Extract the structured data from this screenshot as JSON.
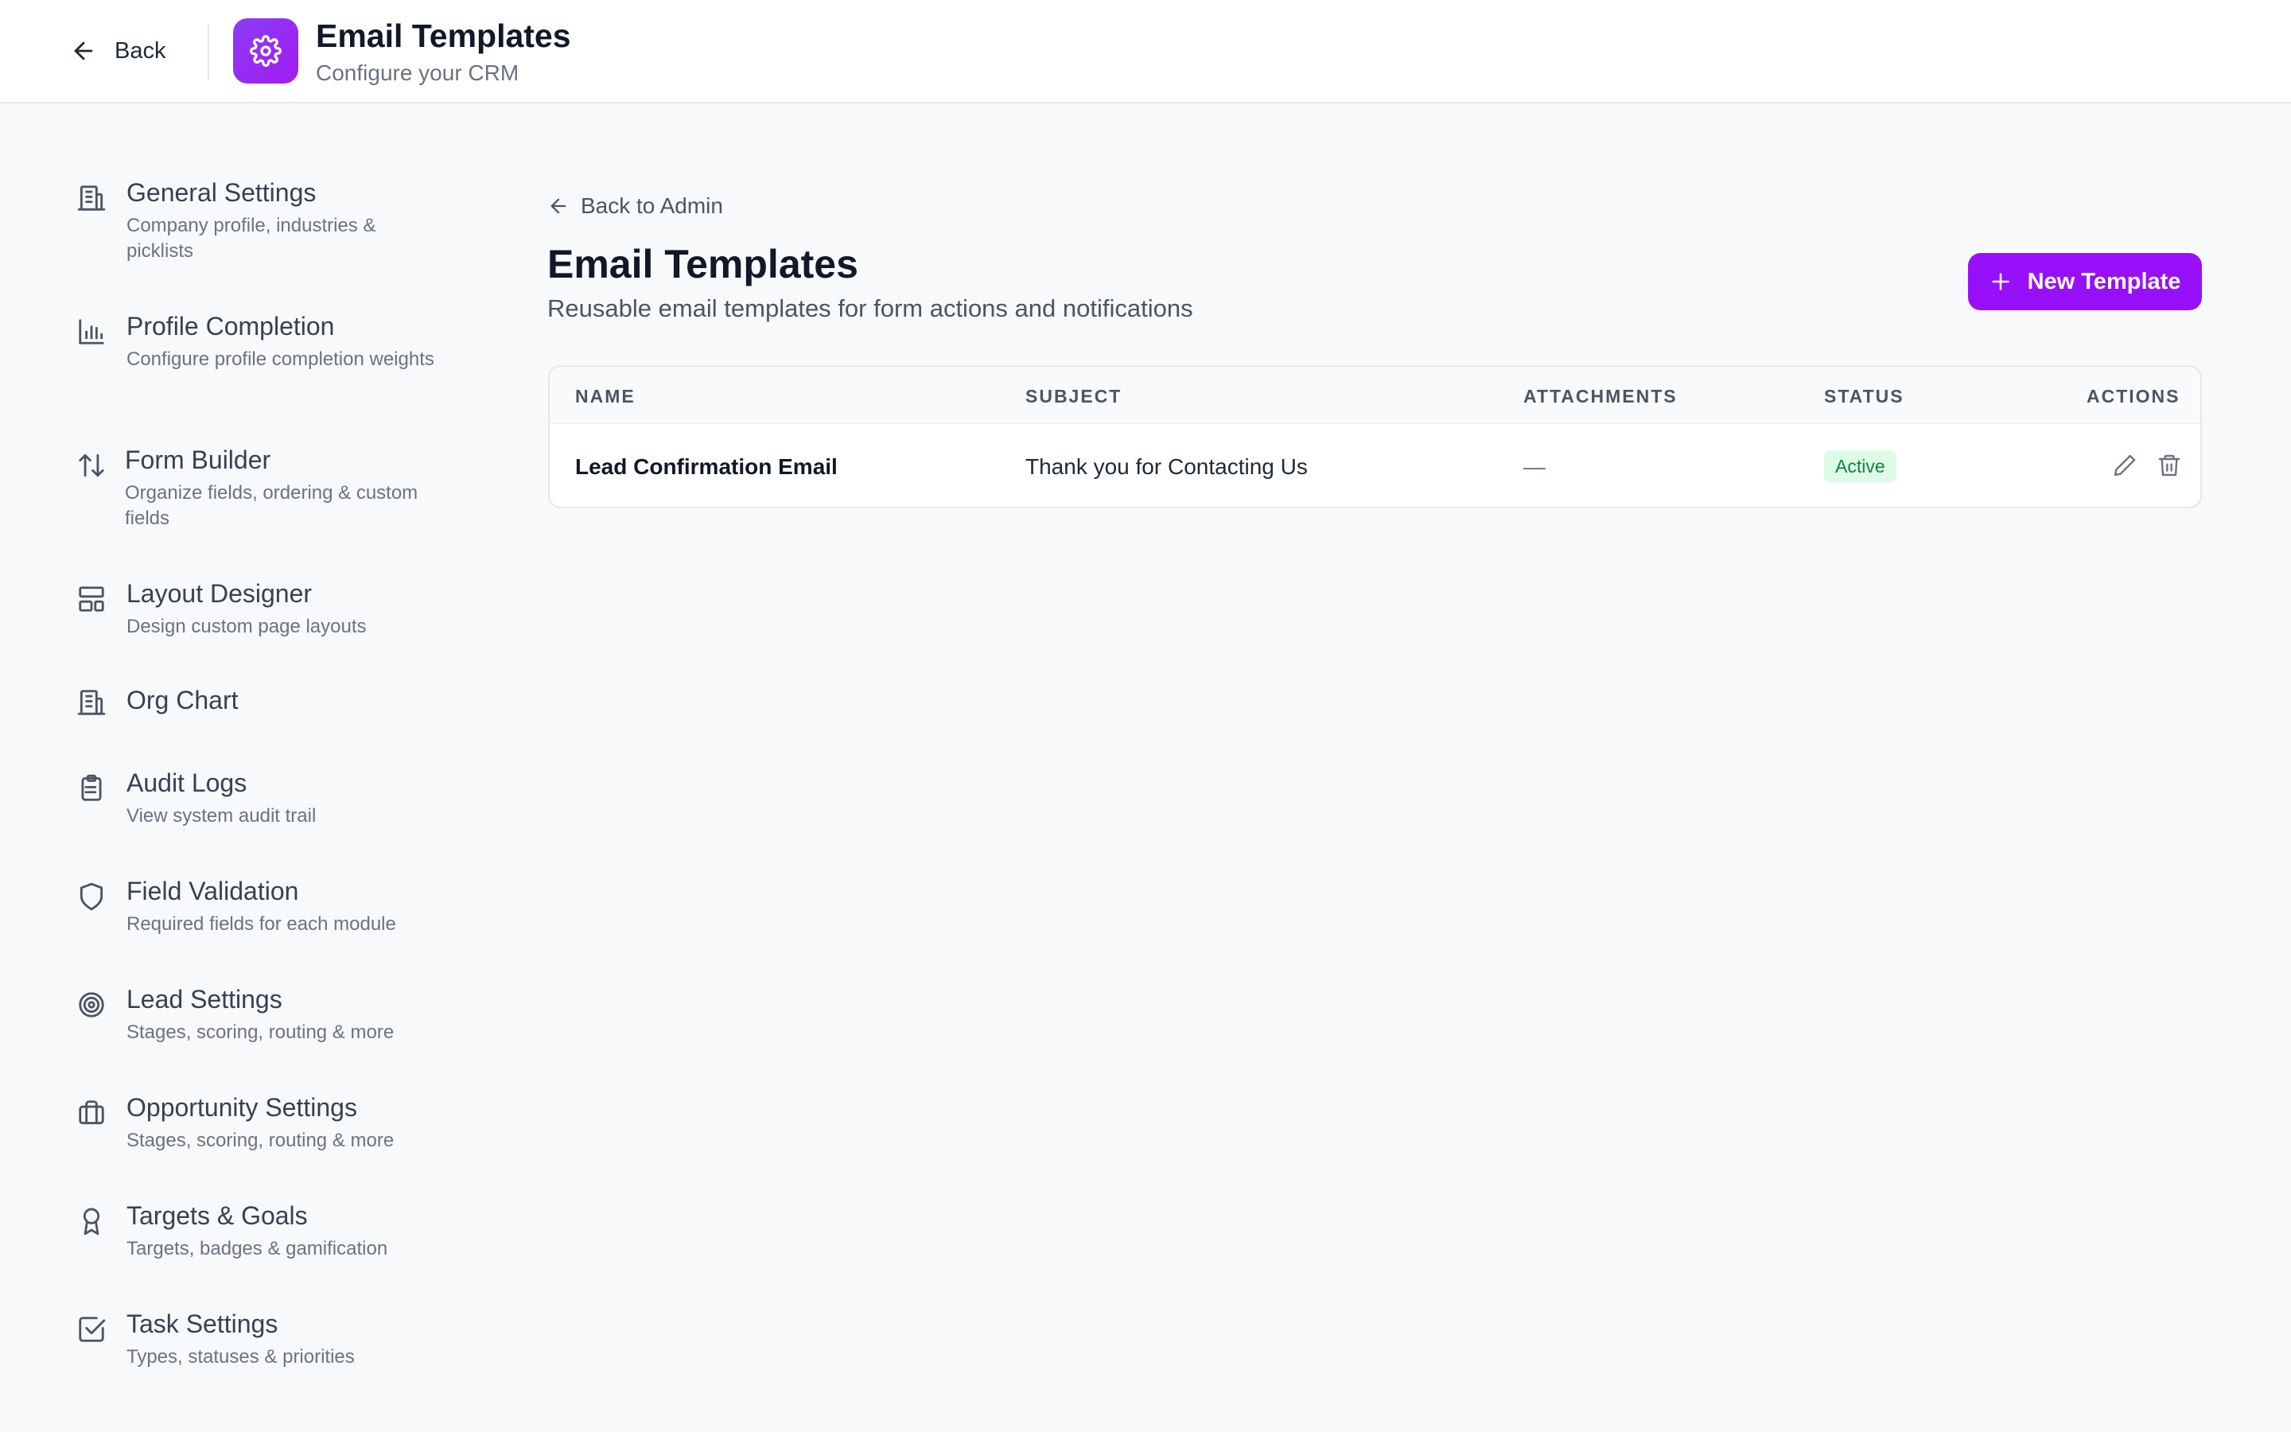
{
  "header": {
    "back_label": "Back",
    "title": "Email Templates",
    "subtitle": "Configure your CRM",
    "app_icon": "gear-icon",
    "accent_color": "#9810fa"
  },
  "sidebar": {
    "items": [
      {
        "label": "General Settings",
        "description": "Company profile, industries & picklists",
        "icon": "building-icon"
      },
      {
        "label": "Profile Completion",
        "description": "Configure profile completion weights",
        "icon": "bar-chart-icon"
      },
      {
        "label": "Form Builder",
        "description": "Organize fields, ordering & custom fields",
        "icon": "sort-arrows-icon"
      },
      {
        "label": "Layout Designer",
        "description": "Design custom page layouts",
        "icon": "layout-icon"
      },
      {
        "label": "Org Chart",
        "description": "",
        "icon": "building-icon"
      },
      {
        "label": "Audit Logs",
        "description": "View system audit trail",
        "icon": "clipboard-list-icon"
      },
      {
        "label": "Field Validation",
        "description": "Required fields for each module",
        "icon": "shield-icon"
      },
      {
        "label": "Lead Settings",
        "description": "Stages, scoring, routing & more",
        "icon": "target-icon"
      },
      {
        "label": "Opportunity Settings",
        "description": "Stages, scoring, routing & more",
        "icon": "briefcase-icon"
      },
      {
        "label": "Targets & Goals",
        "description": "Targets, badges & gamification",
        "icon": "award-icon"
      },
      {
        "label": "Task Settings",
        "description": "Types, statuses & priorities",
        "icon": "check-square-icon"
      }
    ]
  },
  "main": {
    "back_link": "Back to Admin",
    "title": "Email Templates",
    "subtitle": "Reusable email templates for form actions and notifications",
    "new_button_label": "New Template"
  },
  "table": {
    "columns": [
      "Name",
      "Subject",
      "Attachments",
      "Status",
      "Actions"
    ],
    "rows": [
      {
        "name": "Lead Confirmation Email",
        "subject": "Thank you for Contacting Us",
        "attachments": "—",
        "status": "Active",
        "status_color": "#15803d"
      }
    ]
  }
}
